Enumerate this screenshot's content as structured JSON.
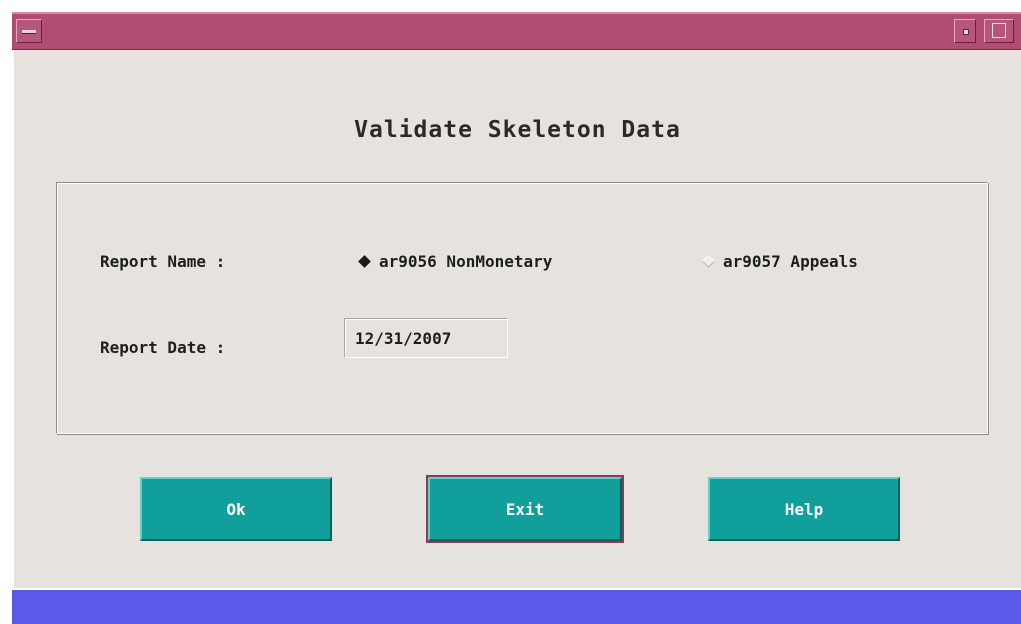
{
  "dialog": {
    "title": "Validate Skeleton Data"
  },
  "form": {
    "report_name_label": "Report Name :",
    "report_date_label": "Report Date :",
    "report_options": [
      {
        "label": "ar9056 NonMonetary",
        "selected": true
      },
      {
        "label": "ar9057 Appeals",
        "selected": false
      }
    ],
    "report_date_value": "12/31/2007"
  },
  "buttons": {
    "ok": "Ok",
    "exit": "Exit",
    "help": "Help"
  },
  "colors": {
    "titlebar": "#b14d72",
    "background": "#e6e3de",
    "button": "#119f9b",
    "status_bar": "#5a5ae8"
  },
  "icons": {
    "window_menu": "window-menu-icon",
    "minimize": "minimize-icon",
    "maximize": "maximize-icon"
  }
}
